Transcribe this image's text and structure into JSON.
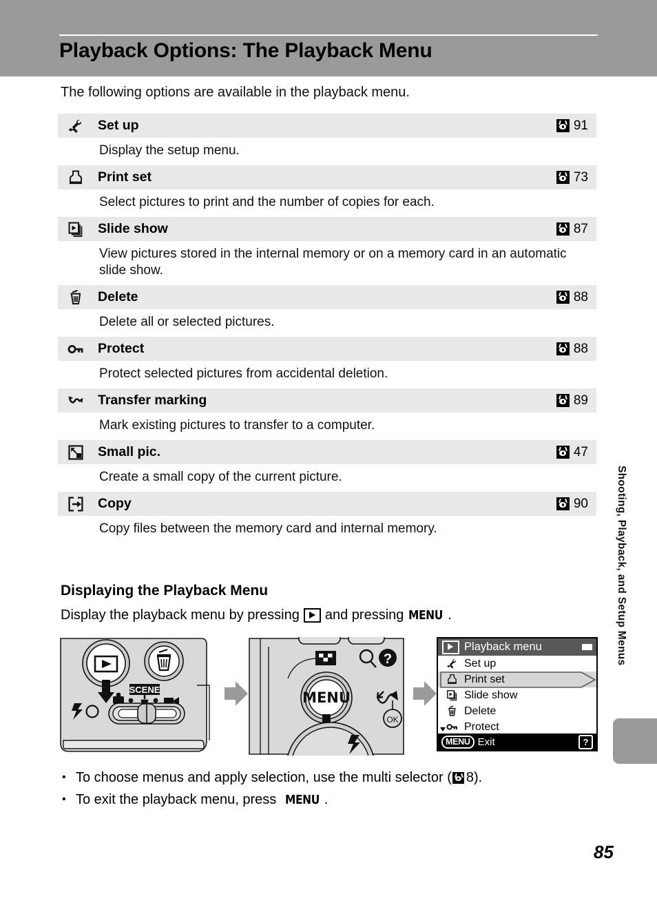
{
  "header": {
    "title": "Playback Options: The Playback Menu"
  },
  "intro": "The following options are available in the playback menu.",
  "options": [
    {
      "icon": "wrench-arrow-icon",
      "label": "Set up",
      "page": "91",
      "desc": "Display the setup menu."
    },
    {
      "icon": "printer-icon",
      "label": "Print set",
      "page": "73",
      "desc": "Select pictures to print and the number of copies for each."
    },
    {
      "icon": "slideshow-icon",
      "label": "Slide show",
      "page": "87",
      "desc": "View pictures stored in the internal memory or on a memory card in an automatic slide show."
    },
    {
      "icon": "trash-icon",
      "label": "Delete",
      "page": "88",
      "desc": "Delete all or selected pictures."
    },
    {
      "icon": "key-icon",
      "label": "Protect",
      "page": "88",
      "desc": "Protect selected pictures from accidental deletion."
    },
    {
      "icon": "transfer-icon",
      "label": "Transfer marking",
      "page": "89",
      "desc": "Mark existing pictures to transfer to a computer."
    },
    {
      "icon": "small-picture-icon",
      "label": "Small pic.",
      "page": "47",
      "desc": "Create a small copy of the current picture."
    },
    {
      "icon": "copy-icon",
      "label": "Copy",
      "page": "90",
      "desc": "Copy files between the memory card and internal memory."
    }
  ],
  "section": {
    "heading": "Displaying the Playback Menu",
    "instruction_before": "Display the playback menu by pressing",
    "instruction_middle": "and pressing",
    "menu_word": "MENU",
    "instruction_after": "."
  },
  "figures": {
    "camera_back": {
      "scene_label": "SCENE",
      "caption_name": "camera-rear-playback-button-diagram"
    },
    "camera_menu": {
      "menu_label": "MENU",
      "ok_label": "OK",
      "caption_name": "camera-rear-menu-button-diagram"
    },
    "lcd": {
      "title": "Playback menu",
      "items": [
        {
          "icon": "wrench-arrow-icon",
          "label": "Set up",
          "selected": false
        },
        {
          "icon": "printer-icon",
          "label": "Print set",
          "selected": true
        },
        {
          "icon": "slideshow-icon",
          "label": "Slide show",
          "selected": false
        },
        {
          "icon": "trash-icon",
          "label": "Delete",
          "selected": false
        },
        {
          "icon": "key-icon",
          "label": "Protect",
          "selected": false
        }
      ],
      "footer_button": "MENU",
      "footer_label": "Exit",
      "help_label": "?"
    }
  },
  "bullets": [
    {
      "before": "To choose menus and apply selection, use the multi selector (",
      "page": "8",
      "after": ")."
    },
    {
      "before": "To exit the playback menu, press",
      "menu_word": "MENU",
      "after": "."
    }
  ],
  "side_tab": {
    "text": "Shooting, Playback, and Setup Menus"
  },
  "page_number": "85",
  "colors": {
    "header_band": "#9a9a9a",
    "row_background": "#e8e8e8",
    "side_tab": "#9a9a9a",
    "lcd_title_bar": "#585858",
    "lcd_selected": "#d6d6d6"
  }
}
